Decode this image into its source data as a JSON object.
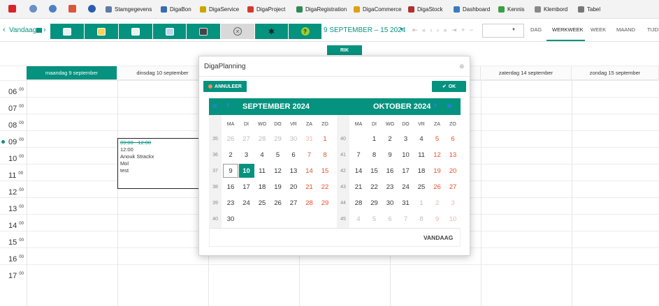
{
  "nav": {
    "items": [
      {
        "label": "Stamgegevens",
        "icon": "database-icon",
        "color": "#5f7aa8"
      },
      {
        "label": "DigaBon",
        "icon": "receipt-icon",
        "color": "#3a6bb3"
      },
      {
        "label": "DigaService",
        "icon": "service-icon",
        "color": "#caa600"
      },
      {
        "label": "DigaProject",
        "icon": "project-icon",
        "color": "#d33a2c"
      },
      {
        "label": "DigaRegistration",
        "icon": "registration-icon",
        "color": "#2e8b57"
      },
      {
        "label": "DigaCommerce",
        "icon": "commerce-icon",
        "color": "#e0a010"
      },
      {
        "label": "DigaStock",
        "icon": "stock-icon",
        "color": "#b03030"
      },
      {
        "label": "Dashboard",
        "icon": "dashboard-icon",
        "color": "#3a7bc0"
      },
      {
        "label": "Kennis",
        "icon": "knowledge-icon",
        "color": "#3aa040"
      },
      {
        "label": "Klembord",
        "icon": "clipboard-icon",
        "color": "#888888"
      },
      {
        "label": "Tabel",
        "icon": "table-icon",
        "color": "#777777"
      }
    ]
  },
  "toolbar": {
    "today_label": "Vandaag",
    "date_range": "9 SEPTEMBER – 15 2024",
    "views": [
      "DAG",
      "WERKWEEK",
      "WEEK",
      "MAAND",
      "TIJDS"
    ],
    "active_view": "WERKWEEK",
    "accent": "#05927f"
  },
  "calendar": {
    "days": [
      "maandag 9 september",
      "dinsdag 10 september",
      "",
      "",
      "",
      "zaterdag 14 september",
      "zondag 15 september"
    ],
    "hours": [
      "06",
      "07",
      "08",
      "09",
      "10",
      "11",
      "12",
      "13",
      "14",
      "15",
      "16",
      "17"
    ],
    "minute_label": "00",
    "resource_label": "RIK",
    "event": {
      "time_struck": "09:00 - 12:00",
      "time": "12:00",
      "person": "Anouk Strackx",
      "place": "Mol",
      "note": "test"
    }
  },
  "modal": {
    "title": "DigaPlanning",
    "cancel_label": "ANNULEER",
    "ok_label": "OK",
    "month_left": "SEPTEMBER 2024",
    "month_right": "OKTOBER 2024",
    "dow": [
      "MA",
      "DI",
      "WO",
      "DO",
      "VR",
      "ZA",
      "ZO"
    ],
    "today_label": "VANDAAG",
    "september": {
      "weeks": [
        "35",
        "36",
        "37",
        "38",
        "39",
        "40"
      ],
      "rows": [
        [
          "26",
          "27",
          "28",
          "29",
          "30",
          "31",
          "1"
        ],
        [
          "2",
          "3",
          "4",
          "5",
          "6",
          "7",
          "8"
        ],
        [
          "9",
          "10",
          "11",
          "12",
          "13",
          "14",
          "15"
        ],
        [
          "16",
          "17",
          "18",
          "19",
          "20",
          "21",
          "22"
        ],
        [
          "23",
          "24",
          "25",
          "26",
          "27",
          "28",
          "29"
        ],
        [
          "30",
          "",
          "",
          "",
          "",
          "",
          ""
        ]
      ],
      "muted_first_row": 6
    },
    "oktober": {
      "weeks": [
        "40",
        "41",
        "42",
        "43",
        "44",
        "45"
      ],
      "rows": [
        [
          "",
          "1",
          "2",
          "3",
          "4",
          "5",
          "6"
        ],
        [
          "7",
          "8",
          "9",
          "10",
          "11",
          "12",
          "13"
        ],
        [
          "14",
          "15",
          "16",
          "17",
          "18",
          "19",
          "20"
        ],
        [
          "21",
          "22",
          "23",
          "24",
          "25",
          "26",
          "27"
        ],
        [
          "28",
          "29",
          "30",
          "31",
          "1",
          "2",
          "3"
        ],
        [
          "4",
          "5",
          "6",
          "7",
          "8",
          "9",
          "10"
        ]
      ]
    },
    "selected_day": "10",
    "today_day": "9"
  }
}
